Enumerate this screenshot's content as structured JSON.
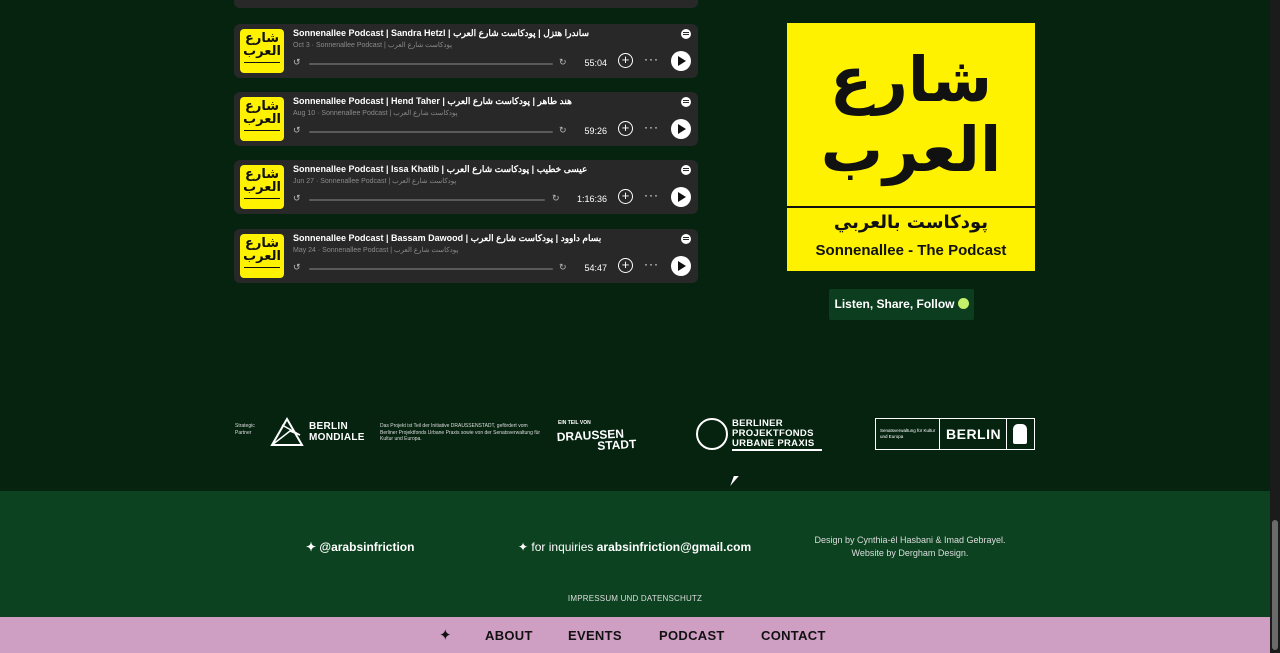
{
  "episodes": [
    {
      "title": "Sonnenallee Podcast | Sandra Hetzl | ساندرا هتزل | پودكاست شارع العرب",
      "meta": "Oct 3 · Sonnenallee Podcast | پودكاست شارع العرب",
      "duration": "55:04"
    },
    {
      "title": "Sonnenallee Podcast | Hend Taher | هند طاهر | پودكاست شارع العرب",
      "meta": "Aug 10 · Sonnenallee Podcast | پودكاست شارع العرب",
      "duration": "59:26"
    },
    {
      "title": "Sonnenallee Podcast | Issa Khatib | عيسى خطيب | پودكاست شارع العرب",
      "meta": "Jun 27 · Sonnenallee Podcast | پودكاست شارع العرب",
      "duration": "1:16:36"
    },
    {
      "title": "Sonnenallee Podcast | Bassam Dawood | بسام داوود | پودكاست شارع العرب",
      "meta": "May 24 · Sonnenallee Podcast | پودكاست شارع العرب",
      "duration": "54:47"
    }
  ],
  "episode_art": {
    "line1": "شارع",
    "line2": "العرب"
  },
  "cover": {
    "line1": "شارع",
    "line2": "العرب",
    "tagline": "پودكاست بالعربي",
    "english": "Sonnenallee - The Podcast"
  },
  "listen_button": "Listen, Share, Follow",
  "partners": {
    "strategic_label_1": "Strategic",
    "strategic_label_2": "Partner",
    "berlin_mondiale_1": "BERLIN",
    "berlin_mondiale_2": "MONDIALE",
    "project_text": "Das Projekt ist Teil der Initiative DRAUSSENSTADT, gefördert vom Berliner Projektfonds Urbane Praxis sowie von der Senatsverwaltung für Kultur und Europa.",
    "draussen_small": "EIN TEIL VON",
    "draussen_1": "DRAUSSEN",
    "draussen_2": "STADT",
    "projektfonds_1": "BERLINER",
    "projektfonds_2": "PROJEKTFONDS",
    "projektfonds_3": "URBANE PRAXIS",
    "senat_small": "Senatsverwaltung für Kultur und Europa",
    "senat_berlin": "BERLIN"
  },
  "footer": {
    "social": "✦ @arabsinfriction",
    "inquiry_prefix": "✦ for inquiries ",
    "inquiry_email": "arabsinfriction@gmail.com",
    "credits_1": "Design by Cynthia-él Hasbani & Imad Gebrayel.",
    "credits_2": "Website by Dergham Design.",
    "impressum": "IMPRESSUM UND DATENSCHUTZ"
  },
  "nav": {
    "star": "✦",
    "about": "ABOUT",
    "events": "EVENTS",
    "podcast": "PODCAST",
    "contact": "CONTACT"
  },
  "colors": {
    "background": "#05230f",
    "footer": "#0c4220",
    "nav": "#cf9fc3",
    "accent_yellow": "#fff200",
    "episode_bg": "#282828"
  }
}
